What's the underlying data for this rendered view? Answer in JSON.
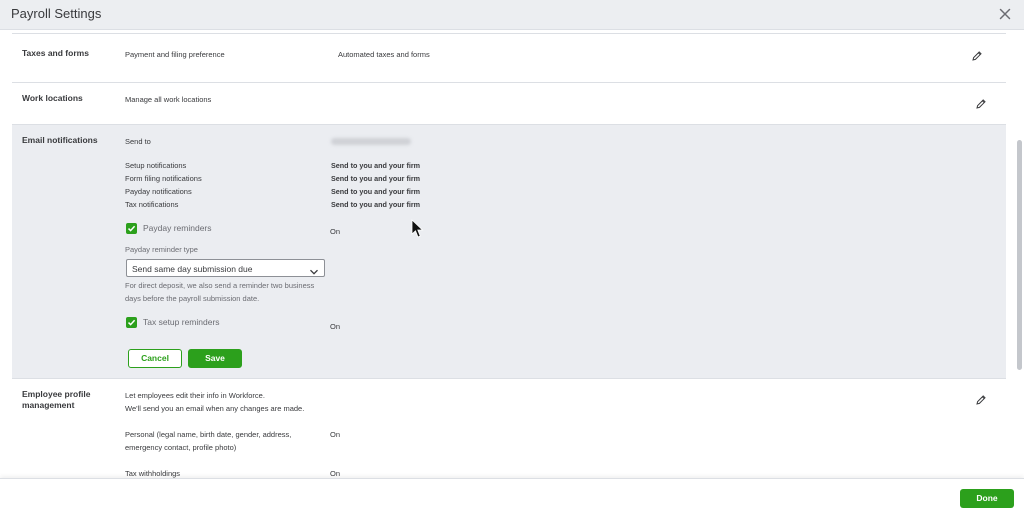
{
  "header": {
    "title": "Payroll Settings",
    "close_icon": "close-icon"
  },
  "taxes": {
    "title": "Taxes and forms",
    "label": "Payment and filing preference",
    "value": "Automated taxes and forms"
  },
  "work": {
    "title": "Work locations",
    "label": "Manage all work locations"
  },
  "email": {
    "title": "Email notifications",
    "send_to_label": "Send to",
    "rows": [
      {
        "label": "Setup notifications",
        "value": "Send to you and your firm"
      },
      {
        "label": "Form filing notifications",
        "value": "Send to you and your firm"
      },
      {
        "label": "Payday notifications",
        "value": "Send to you and your firm"
      },
      {
        "label": "Tax notifications",
        "value": "Send to you and your firm"
      }
    ],
    "payday_reminders": {
      "label": "Payday reminders",
      "checked": true,
      "status": "On"
    },
    "reminder_type_label": "Payday reminder type",
    "reminder_type_value": "Send same day submission due",
    "help_line1": "For direct deposit, we also send a reminder two business",
    "help_line2": "days before the payroll submission date.",
    "tax_setup_reminders": {
      "label": "Tax setup reminders",
      "checked": true,
      "status": "On"
    },
    "cancel_label": "Cancel",
    "save_label": "Save"
  },
  "employee": {
    "title_line1": "Employee profile",
    "title_line2": "management",
    "desc_line1": "Let employees edit their info in Workforce.",
    "desc_line2": "We'll send you an email when any changes are made.",
    "personal_line1": "Personal (legal name, birth date, gender, address,",
    "personal_line2": "emergency contact, profile photo)",
    "personal_status": "On",
    "tax_label": "Tax withholdings",
    "tax_status": "On"
  },
  "footer": {
    "done_label": "Done"
  },
  "colors": {
    "accent": "#2ca01c",
    "header_bg": "#eceef1",
    "active_section_bg": "#ebedf1"
  }
}
